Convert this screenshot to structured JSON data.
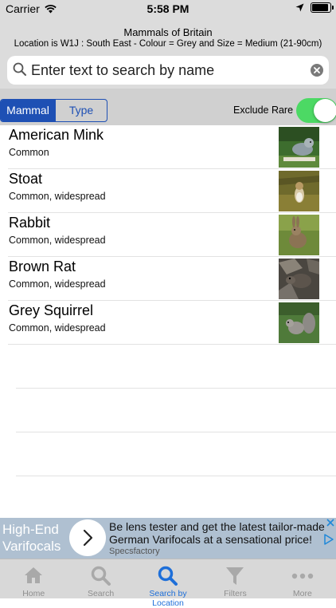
{
  "status_bar": {
    "carrier": "Carrier",
    "time": "5:58 PM"
  },
  "header": {
    "title": "Mammals of Britain",
    "subtitle": "Location is W1J : South East - Colour = Grey and Size = Medium (21-90cm)"
  },
  "search": {
    "placeholder": "Enter text to search by name"
  },
  "filters": {
    "segments": [
      "Mammal",
      "Type"
    ],
    "selected_segment": "Mammal",
    "exclude_rare_label": "Exclude Rare",
    "exclude_rare_on": true
  },
  "results": [
    {
      "name": "American Mink",
      "status": "Common",
      "thumb": "mink"
    },
    {
      "name": "Stoat",
      "status": "Common, widespread",
      "thumb": "stoat"
    },
    {
      "name": "Rabbit",
      "status": "Common, widespread",
      "thumb": "rabbit"
    },
    {
      "name": "Brown Rat",
      "status": "Common, widespread",
      "thumb": "rat"
    },
    {
      "name": "Grey Squirrel",
      "status": "Common, widespread",
      "thumb": "squirrel"
    }
  ],
  "ad": {
    "headline": "High-End Varifocals",
    "body": "Be lens tester and get the latest tailor-made German Varifocals at a sensational price!",
    "source": "Specsfactory"
  },
  "tabs": [
    {
      "label": "Home",
      "icon": "home-icon",
      "active": false
    },
    {
      "label": "Search",
      "icon": "search-icon",
      "active": false
    },
    {
      "label": "Search by Location",
      "icon": "search-icon",
      "active": true
    },
    {
      "label": "Filters",
      "icon": "filter-icon",
      "active": false
    },
    {
      "label": "More",
      "icon": "more-icon",
      "active": false
    }
  ],
  "colors": {
    "accent": "#1e50b4",
    "toggle_on": "#4cd964",
    "header_bg": "#dcdcdc",
    "tab_active": "#1e6fd9",
    "ad_bg": "#afc0d1"
  }
}
